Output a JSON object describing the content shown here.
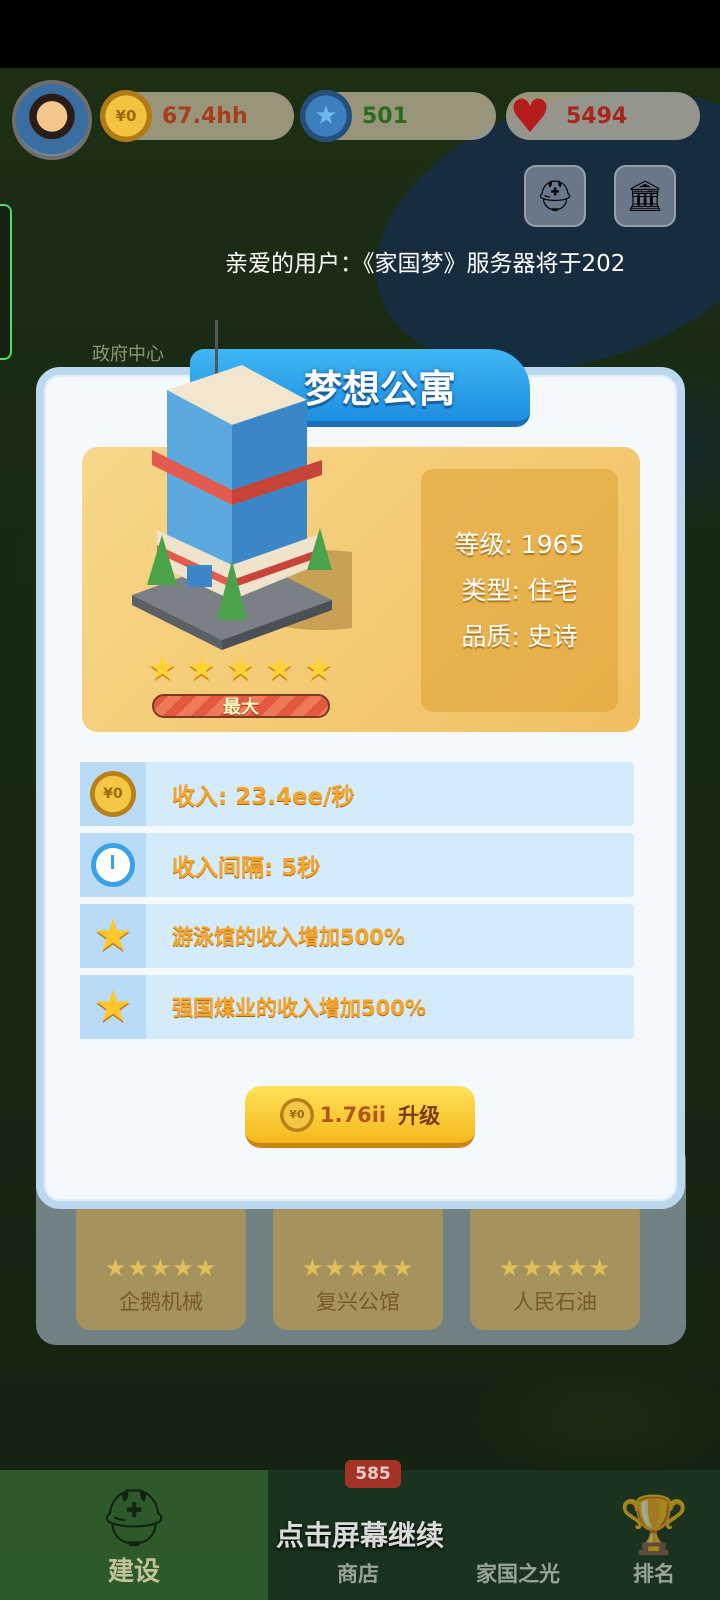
{
  "resources": {
    "coins": "67.4hh",
    "stars": "501",
    "hearts": "5494"
  },
  "notice": "亲爱的用户：《家国梦》服务器将于202",
  "map_label": "政府中心",
  "building": {
    "name": "梦想公寓",
    "level": "等级: 1965",
    "type": "类型: 住宅",
    "quality": "品质: 史诗",
    "stars": 5,
    "max_label": "最大"
  },
  "stats": [
    {
      "icon": "coin-icon",
      "text": "收入: 23.4ee/秒"
    },
    {
      "icon": "clock-icon",
      "text": "收入间隔: 5秒"
    },
    {
      "icon": "star-icon",
      "text": "游泳馆的收入增加500%"
    },
    {
      "icon": "star-icon",
      "text": "强国煤业的收入增加500%"
    }
  ],
  "upgrade": {
    "cost": "1.76ii",
    "label": "升级"
  },
  "background_cards": [
    {
      "name": "企鹅机械"
    },
    {
      "name": "复兴公馆"
    },
    {
      "name": "人民石油"
    }
  ],
  "nav": {
    "build": "建设",
    "shop": "商店",
    "shop_badge": "585",
    "light": "家国之光",
    "rank": "排名"
  },
  "continue_hint": "点击屏幕继续",
  "colors": {
    "title_blue": "#1e8ee0",
    "stat_text": "#f5a52a",
    "upgrade_yellow": "#f5b81c"
  }
}
